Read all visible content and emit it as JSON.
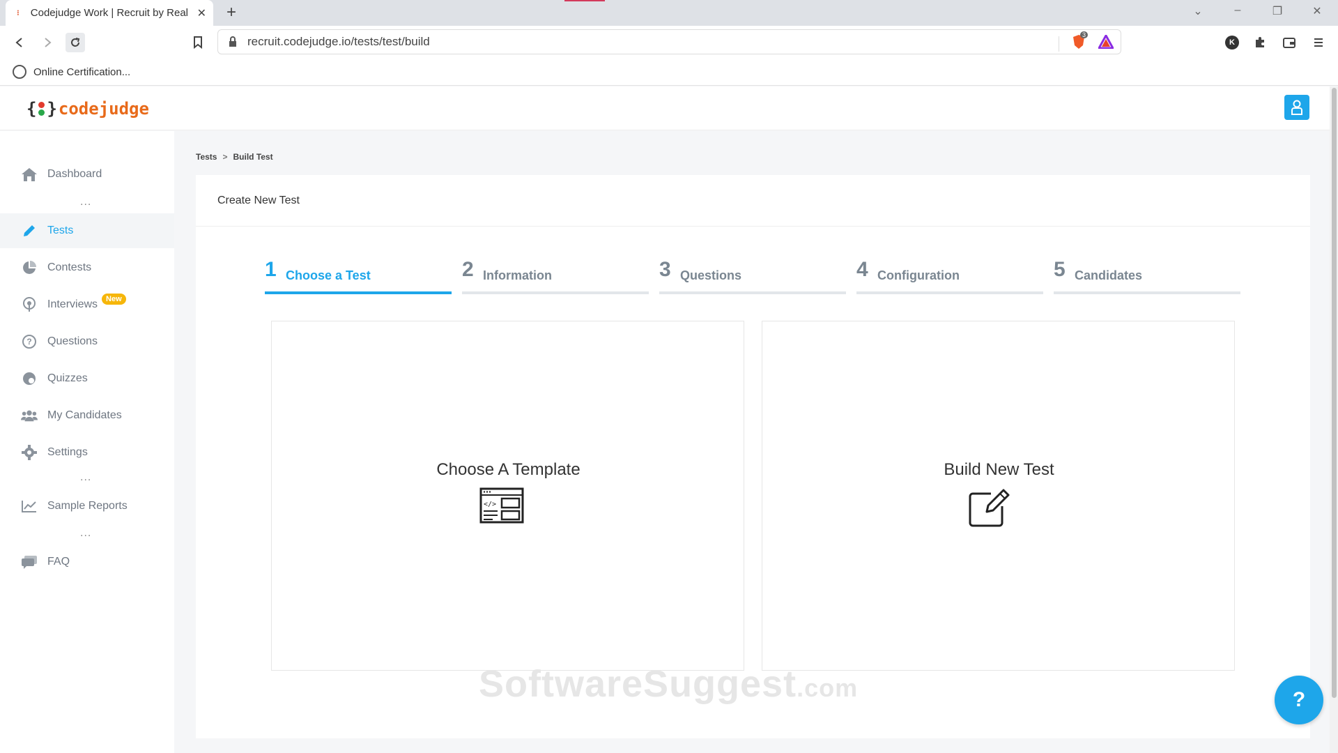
{
  "browser": {
    "tab_title": "Codejudge Work | Recruit by Real",
    "new_tab_label": "+",
    "url": "recruit.codejudge.io/tests/test/build",
    "bookmark_label": "Online Certification...",
    "brave_badge_count": "3",
    "profile_letter": "K"
  },
  "header": {
    "logo_open_brace": "{",
    "logo_close_brace": "}",
    "logo_text": "codejudge"
  },
  "sidebar": {
    "items": [
      {
        "label": "Dashboard",
        "icon": "home-icon"
      },
      {
        "label": "Tests",
        "icon": "pencil-icon",
        "active": true
      },
      {
        "label": "Contests",
        "icon": "pie-chart-icon"
      },
      {
        "label": "Interviews",
        "icon": "podcast-icon",
        "badge": "New"
      },
      {
        "label": "Questions",
        "icon": "question-circle-icon"
      },
      {
        "label": "Quizzes",
        "icon": "quiz-icon"
      },
      {
        "label": "My Candidates",
        "icon": "users-icon"
      },
      {
        "label": "Settings",
        "icon": "gear-icon"
      },
      {
        "label": "Sample Reports",
        "icon": "line-chart-icon"
      },
      {
        "label": "FAQ",
        "icon": "chat-icon"
      }
    ],
    "separator": "..."
  },
  "breadcrumb": {
    "items": [
      "Tests",
      "Build Test"
    ],
    "separator": ">"
  },
  "main": {
    "card_title": "Create New Test",
    "steps": [
      {
        "num": "1",
        "label": "Choose a Test",
        "active": true
      },
      {
        "num": "2",
        "label": "Information"
      },
      {
        "num": "3",
        "label": "Questions"
      },
      {
        "num": "4",
        "label": "Configuration"
      },
      {
        "num": "5",
        "label": "Candidates"
      }
    ],
    "options": [
      {
        "title": "Choose A Template",
        "icon": "code-template-icon"
      },
      {
        "title": "Build New Test",
        "icon": "edit-note-icon"
      }
    ]
  },
  "watermark": {
    "main": "SoftwareSuggest",
    "suffix": ".com"
  },
  "help_button": "?",
  "colors": {
    "accent": "#1ea6ea",
    "logo_orange": "#e86a1a",
    "badge_yellow": "#f6b60a",
    "step_inactive": "#7a8691"
  }
}
